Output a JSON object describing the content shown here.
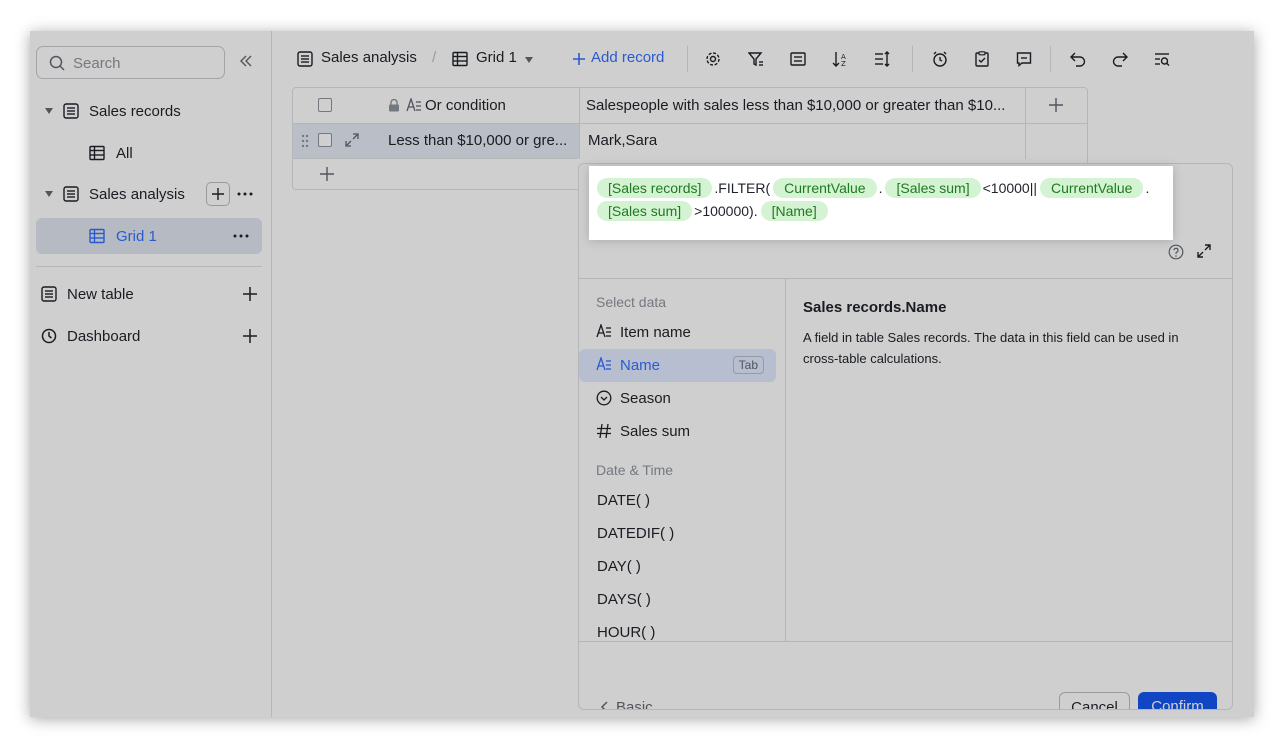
{
  "sidebar": {
    "search_placeholder": "Search",
    "tables": [
      {
        "label": "Sales records",
        "views": [
          {
            "label": "All"
          }
        ]
      },
      {
        "label": "Sales analysis",
        "views": [
          {
            "label": "Grid 1"
          }
        ]
      }
    ],
    "new_table_label": "New table",
    "dashboard_label": "Dashboard"
  },
  "toolbar": {
    "table_name": "Sales analysis",
    "separator": "/",
    "view_name": "Grid 1",
    "add_record_label": "Add record"
  },
  "grid": {
    "columns": [
      "Or condition",
      "Salespeople with sales less than $10,000 or greater than $10..."
    ],
    "rows": [
      [
        "Less than $10,000 or gre...",
        "Mark,Sara"
      ]
    ]
  },
  "formula": {
    "tokens": [
      {
        "kind": "chip",
        "text": "[Sales records]"
      },
      {
        "kind": "text",
        "text": ".FILTER("
      },
      {
        "kind": "chip",
        "text": "CurrentValue"
      },
      {
        "kind": "text",
        "text": "."
      },
      {
        "kind": "chip",
        "text": "[Sales sum]"
      },
      {
        "kind": "text",
        "text": "<10000||"
      },
      {
        "kind": "chip",
        "text": "CurrentValue"
      },
      {
        "kind": "text",
        "text": "."
      },
      {
        "kind": "chip",
        "text": "[Sales sum]"
      },
      {
        "kind": "text",
        "text": ">100000)."
      },
      {
        "kind": "chip",
        "text": "[Name]"
      }
    ]
  },
  "panel": {
    "select_data_heading": "Select data",
    "fields": [
      {
        "label": "Item name",
        "icon": "text-field-icon"
      },
      {
        "label": "Name",
        "icon": "text-field-icon",
        "selected": true,
        "badge": "Tab"
      },
      {
        "label": "Season",
        "icon": "single-select-icon"
      },
      {
        "label": "Sales sum",
        "icon": "number-field-icon"
      }
    ],
    "datetime_heading": "Date & Time",
    "functions": [
      "DATE( )",
      "DATEDIF( )",
      "DAY( )",
      "DAYS( )",
      "HOUR( )"
    ],
    "detail_title": "Sales records.Name",
    "detail_body": "A field in table Sales records. The data in this field can be used in cross-table calculations.",
    "basic_label": "Basic",
    "cancel_label": "Cancel",
    "confirm_label": "Confirm"
  },
  "colors": {
    "accent": "#3370ff",
    "chip_bg": "#d3f3d2",
    "chip_text": "#1f7a1f",
    "confirm_bg": "#1456f0"
  }
}
